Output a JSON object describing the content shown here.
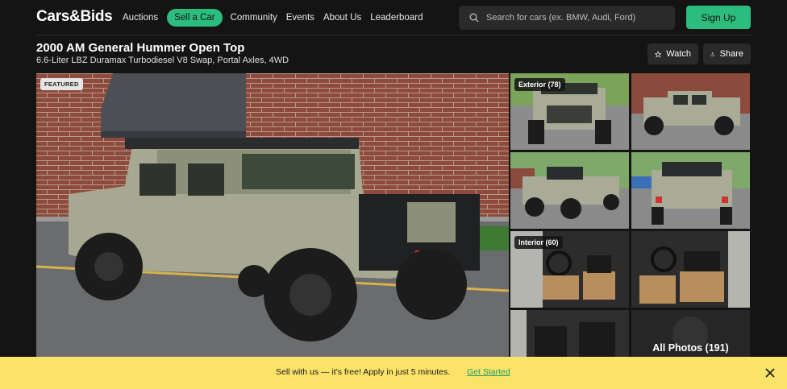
{
  "header": {
    "logo": "Cars&Bids",
    "nav": [
      "Auctions",
      "Sell a Car",
      "Community",
      "Events",
      "About Us",
      "Leaderboard"
    ],
    "search_placeholder": "Search for cars (ex. BMW, Audi, Ford)",
    "signup_label": "Sign Up"
  },
  "listing": {
    "title": "2000 AM General Hummer Open Top",
    "subtitle": "6.6-Liter LBZ Duramax Turbodiesel V8 Swap, Portal Axles, 4WD",
    "watch_label": "Watch",
    "share_label": "Share"
  },
  "gallery": {
    "featured_badge": "FEATURED",
    "exterior_label": "Exterior (78)",
    "interior_label": "Interior (60)",
    "all_photos_label": "All Photos (191)"
  },
  "banner": {
    "text": "Sell with us — it's free! Apply in just 5 minutes.",
    "link": "Get Started"
  },
  "colors": {
    "accent": "#2bbd7e",
    "background": "#141414",
    "banner": "#fbe36a"
  },
  "icons": [
    "search-icon",
    "star-icon",
    "share-icon",
    "close-icon"
  ]
}
